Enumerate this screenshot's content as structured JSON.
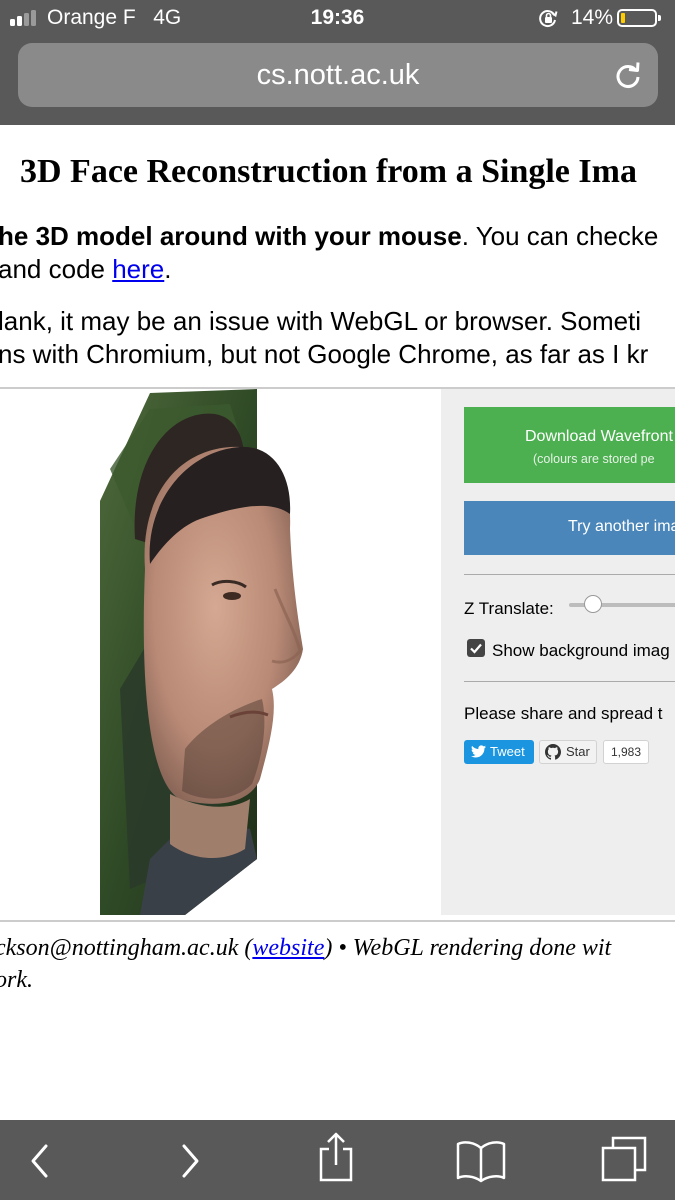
{
  "status_bar": {
    "carrier": "Orange F",
    "network": "4G",
    "time": "19:36",
    "battery_percent": "14%",
    "battery_level": 0.14,
    "battery_color": "#ffcc00"
  },
  "browser": {
    "url": "cs.nott.ac.uk",
    "toolbar_icons": [
      "back-icon",
      "forward-icon",
      "share-icon",
      "bookmarks-icon",
      "tabs-icon"
    ]
  },
  "page": {
    "title": "3D Face Reconstruction from a Single Ima",
    "intro_line1_bold": "he 3D model around with your mouse",
    "intro_line1_rest": ". You can checke",
    "intro_line2_prefix": "and code ",
    "intro_line2_link": "here",
    "intro_line2_suffix": ".",
    "warning_line1": "lank, it may be an issue with WebGL or browser. Someti",
    "warning_line2": "ns with Chromium, but not Google Chrome, as far as I kr"
  },
  "panel": {
    "download_label": "Download Wavefront",
    "download_note": "(colours are stored pe",
    "try_label": "Try another ima",
    "z_translate_label": "Z Translate:",
    "z_translate_value": 0.2,
    "show_background_label": "Show background imag",
    "show_background_checked": true,
    "share_text": "Please share and spread t",
    "tweet_label": "Tweet",
    "star_label": "Star",
    "star_count": "1,983",
    "colors": {
      "download": "#4caf50",
      "try": "#4a86b9",
      "tweet": "#1b95e0"
    }
  },
  "footer": {
    "line1_prefix": "ckson@nottingham.ac.uk (",
    "line1_link": "website",
    "line1_suffix": ") • WebGL rendering done wit",
    "line2": "ork."
  }
}
